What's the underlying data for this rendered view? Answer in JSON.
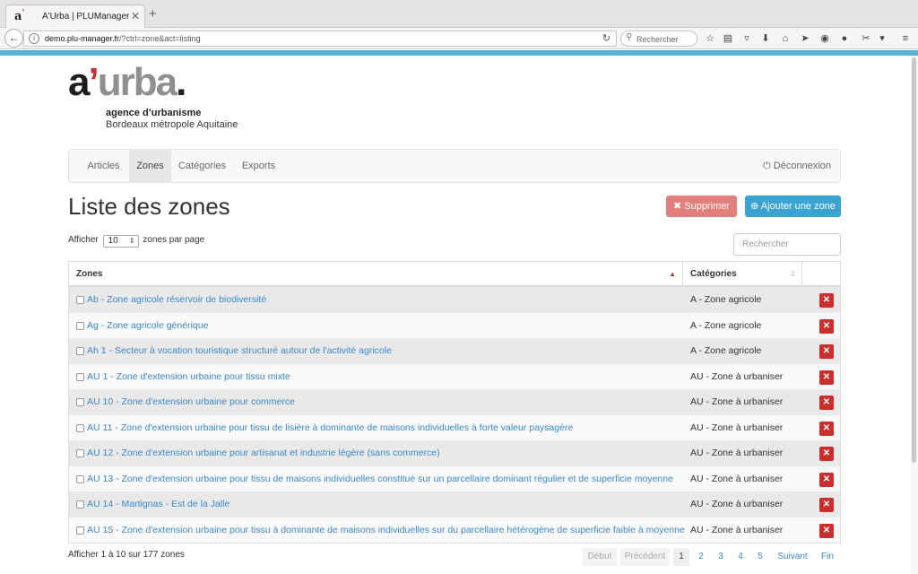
{
  "browser": {
    "tab_title": "A'Urba | PLUManager",
    "url_host": "demo.plu-manager.fr",
    "url_path": "/?ctrl=zone&act=listing",
    "search_placeholder": "Rechercher"
  },
  "logo": {
    "word_a": "a",
    "word_apos": "’",
    "word_urba": "urba",
    "word_dot": ".",
    "line1": "agence d’urbanisme",
    "line2": "Bordeaux métropole Aquitaine"
  },
  "nav": {
    "items": [
      {
        "label": "Articles"
      },
      {
        "label": "Zones",
        "active": true
      },
      {
        "label": "Catégories"
      },
      {
        "label": "Exports"
      }
    ],
    "logout": "Déconnexion"
  },
  "page": {
    "title": "Liste des zones",
    "delete_button": "Supprimer",
    "add_button": "Ajouter une zone",
    "length_prefix": "Afficher",
    "length_value": "10",
    "length_suffix": "zones par page",
    "search_placeholder": "Rechercher"
  },
  "table": {
    "headers": {
      "zones": "Zones",
      "categories": "Catégories"
    },
    "rows": [
      {
        "zone": "Ab - Zone agricole réservoir de biodiversité",
        "category": "A - Zone agricole"
      },
      {
        "zone": "Ag - Zone agricole générique",
        "category": "A - Zone agricole"
      },
      {
        "zone": "Ah 1 - Secteur à vocation touristique structuré autour de l'activité agricole",
        "category": "A - Zone agricole"
      },
      {
        "zone": "AU 1 - Zone d'extension urbaine pour tissu mixte",
        "category": "AU - Zone à urbaniser"
      },
      {
        "zone": "AU 10 - Zone d'extension urbaine pour commerce",
        "category": "AU - Zone à urbaniser"
      },
      {
        "zone": "AU 11 - Zone d'extension urbaine pour tissu de lisière à dominante de maisons individuelles à forte valeur paysagère",
        "category": "AU - Zone à urbaniser"
      },
      {
        "zone": "AU 12 - Zone d'extension urbaine pour artisanat et industrie légère (sans commerce)",
        "category": "AU - Zone à urbaniser"
      },
      {
        "zone": "AU 13 - Zone d'extension urbaine pour tissu de maisons individuelles constitué sur un parcellaire dominant régulier et de superficie moyenne",
        "category": "AU - Zone à urbaniser"
      },
      {
        "zone": "AU 14 - Martignas - Est de la Jalle",
        "category": "AU - Zone à urbaniser"
      },
      {
        "zone": "AU 15 - Zone d'extension urbaine pour tissu à dominante de maisons individuelles sur du parcellaire hétérogène de superficie faible à moyenne",
        "category": "AU - Zone à urbaniser"
      }
    ]
  },
  "footer": {
    "info": "Afficher 1 à 10 sur 177 zones",
    "pager": {
      "first": "Début",
      "prev": "Précédent",
      "pages": [
        "1",
        "2",
        "3",
        "4",
        "5"
      ],
      "next": "Suivant",
      "last": "Fin"
    }
  }
}
